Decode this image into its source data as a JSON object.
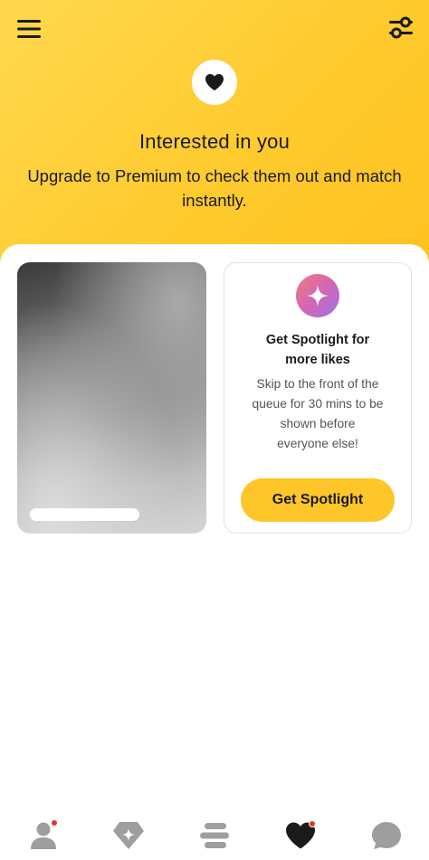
{
  "header": {
    "title": "Interested in you",
    "subtitle": "Upgrade to Premium to check them out and match instantly.",
    "menu_icon": "hamburger-menu-icon",
    "filter_icon": "filter-sliders-icon",
    "badge_icon": "heart-icon"
  },
  "spotlight": {
    "icon": "sparkle-icon",
    "title_line1": "Get Spotlight for",
    "title_line2": "more likes",
    "desc_line1": "Skip to the front of the",
    "desc_line2": "queue for 30 mins to be",
    "desc_line3": "shown before",
    "desc_line4": "everyone else!",
    "button_label": "Get Spotlight"
  },
  "nav": {
    "items": [
      {
        "icon": "profile-icon",
        "active": false,
        "has_dot": true
      },
      {
        "icon": "diamond-star-icon",
        "active": false,
        "has_dot": false
      },
      {
        "icon": "stack-icon",
        "active": false,
        "has_dot": false
      },
      {
        "icon": "heart-icon",
        "active": true,
        "has_dot": true
      },
      {
        "icon": "chat-bubble-icon",
        "active": false,
        "has_dot": false
      }
    ]
  },
  "colors": {
    "brand_yellow": "#FFC629",
    "inactive_icon": "#9e9e9e",
    "active_icon": "#1a1a1a",
    "notification": "#E0352B"
  }
}
